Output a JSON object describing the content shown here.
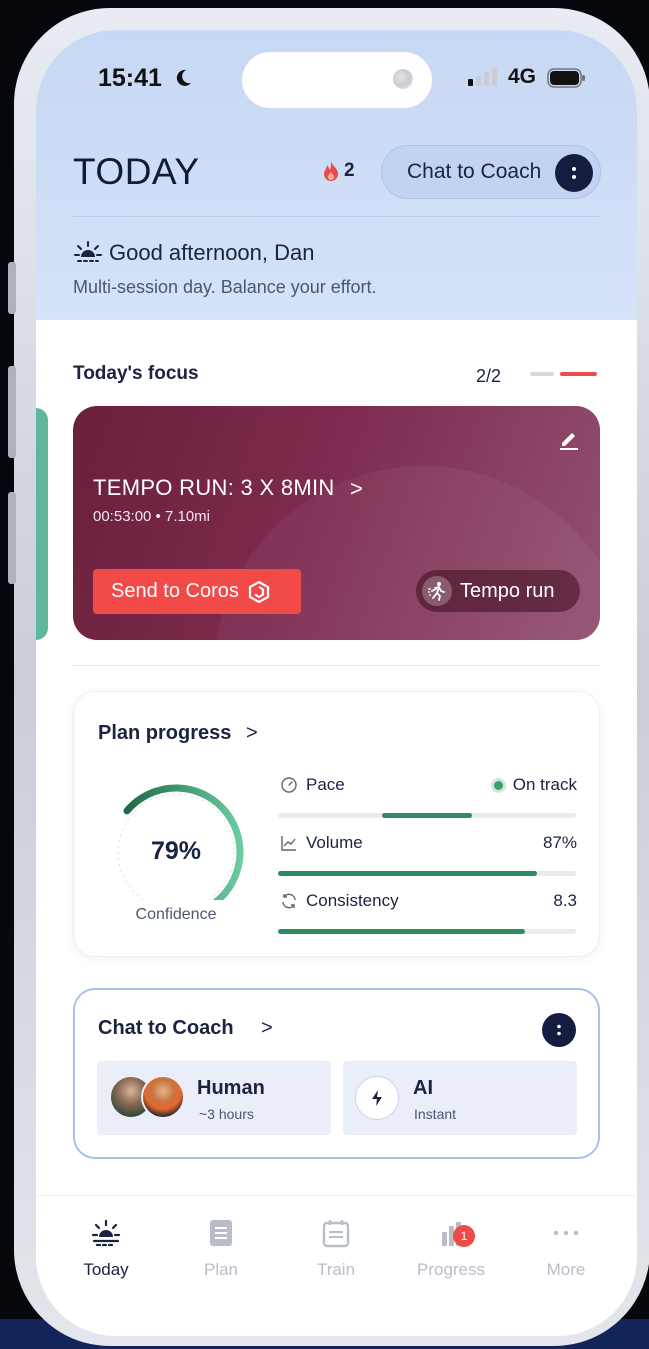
{
  "status_bar": {
    "time": "15:41",
    "network": "4G"
  },
  "header": {
    "title": "TODAY",
    "streak_count": "2",
    "coach_button_label": "Chat to Coach",
    "greeting": "Good afternoon, Dan",
    "subtext": "Multi-session day. Balance your effort."
  },
  "focus": {
    "title": "Today's focus",
    "counter": "2/2",
    "workout": {
      "name": "TEMPO RUN: 3 X 8MIN",
      "chevron": ">",
      "meta": "00:53:00 • 7.10mi",
      "send_label": "Send to Coros",
      "type_label": "Tempo run"
    }
  },
  "plan_progress": {
    "title": "Plan progress",
    "chevron": ">",
    "confidence_value": "79%",
    "confidence_fraction": 0.79,
    "confidence_label": "Confidence",
    "metrics": [
      {
        "label": "Pace",
        "value": "On track",
        "icon": "pace-gauge-icon",
        "fill": 0.3,
        "fill_start": 0.35
      },
      {
        "label": "Volume",
        "value": "87%",
        "icon": "volume-chart-icon",
        "fill": 0.87,
        "fill_start": 0
      },
      {
        "label": "Consistency",
        "value": "8.3",
        "icon": "consistency-refresh-icon",
        "fill": 0.83,
        "fill_start": 0
      }
    ]
  },
  "chat_coach": {
    "title": "Chat to Coach",
    "chevron": ">",
    "options": [
      {
        "title": "Human",
        "sub": "~3 hours"
      },
      {
        "title": "AI",
        "sub": "Instant"
      }
    ]
  },
  "tabs": [
    {
      "label": "Today",
      "icon": "sunrise-icon",
      "active": true
    },
    {
      "label": "Plan",
      "icon": "document-icon",
      "active": false
    },
    {
      "label": "Train",
      "icon": "calendar-icon",
      "active": false
    },
    {
      "label": "Progress",
      "icon": "bar-chart-icon",
      "active": false,
      "badge": "1"
    },
    {
      "label": "More",
      "icon": "ellipsis-icon",
      "active": false
    }
  ],
  "colors": {
    "header_bg": "#c7d8f4",
    "accent_red": "#f24a48",
    "card_maroon": "#7d2b4e",
    "progress_green": "#2e8c60",
    "navy": "#141c3f"
  }
}
